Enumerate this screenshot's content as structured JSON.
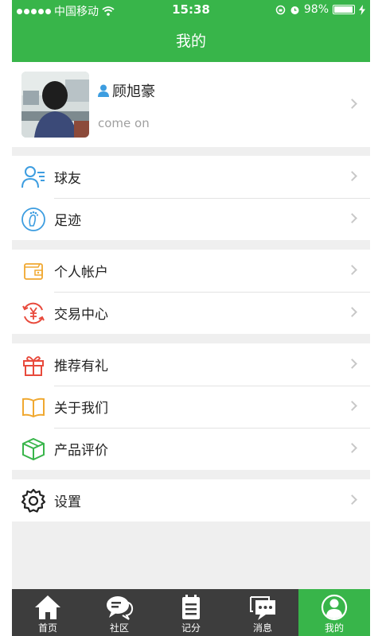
{
  "status_bar": {
    "carrier": "中国移动",
    "time": "15:38",
    "battery": "98%",
    "battery_level": 0.98
  },
  "nav": {
    "title": "我的"
  },
  "profile": {
    "name": "顾旭豪",
    "motto": "come on"
  },
  "groups": [
    [
      {
        "label": "球友",
        "icon": "friends-icon",
        "color": "#3d9de0"
      },
      {
        "label": "足迹",
        "icon": "footprint-icon",
        "color": "#3d9de0"
      }
    ],
    [
      {
        "label": "个人帐户",
        "icon": "wallet-icon",
        "color": "#f0a830"
      },
      {
        "label": "交易中心",
        "icon": "yen-exchange-icon",
        "color": "#e84a3c"
      }
    ],
    [
      {
        "label": "推荐有礼",
        "icon": "gift-icon",
        "color": "#e84a3c"
      },
      {
        "label": "关于我们",
        "icon": "book-icon",
        "color": "#f0a830"
      },
      {
        "label": "产品评价",
        "icon": "box-icon",
        "color": "#38b54a"
      }
    ],
    [
      {
        "label": "设置",
        "icon": "gear-icon",
        "color": "#222222"
      }
    ]
  ],
  "tabbar": {
    "tabs": [
      {
        "label": "首页",
        "icon": "home-icon"
      },
      {
        "label": "社区",
        "icon": "chat-bubble-icon"
      },
      {
        "label": "记分",
        "icon": "scorecard-icon"
      },
      {
        "label": "消息",
        "icon": "message-icon"
      },
      {
        "label": "我的",
        "icon": "user-circle-icon"
      }
    ],
    "active_index": 4
  },
  "colors": {
    "brand": "#38b54a",
    "tabbar_bg": "#3d3d3d",
    "page_bg": "#efefef"
  }
}
